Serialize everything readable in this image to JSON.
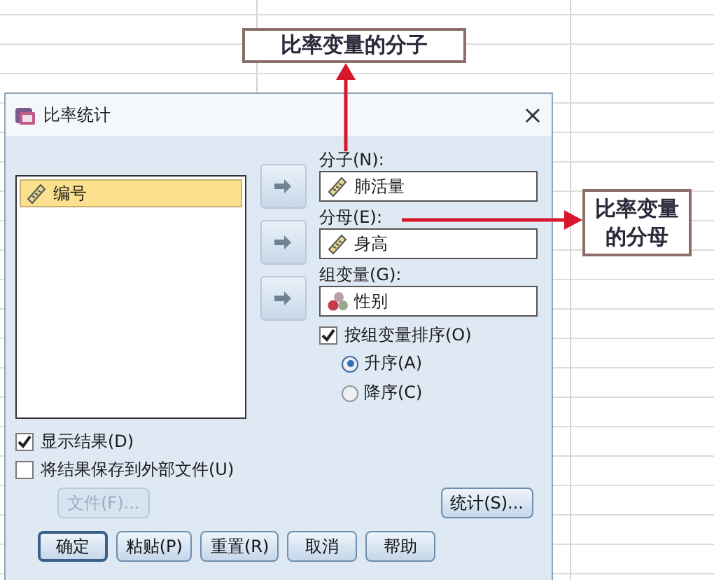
{
  "window": {
    "title": "比率统计"
  },
  "source_list": {
    "items": [
      {
        "label": "编号",
        "selected": true
      }
    ]
  },
  "targets": [
    {
      "label": "分子(N):",
      "value": "肺活量",
      "kind": "scale"
    },
    {
      "label": "分母(E):",
      "value": "身高",
      "kind": "scale"
    },
    {
      "label": "组变量(G):",
      "value": "性别",
      "kind": "nominal"
    }
  ],
  "sort_by_group": {
    "label": "按组变量排序(O)",
    "checked": true
  },
  "sort_order": [
    {
      "label": "升序(A)",
      "selected": true
    },
    {
      "label": "降序(C)",
      "selected": false
    }
  ],
  "options": [
    {
      "label": "显示结果(D)",
      "checked": true
    },
    {
      "label": "将结果保存到外部文件(U)",
      "checked": false
    }
  ],
  "file_button": {
    "label": "文件(F)...",
    "disabled": true
  },
  "statistics_button": {
    "label": "统计(S)..."
  },
  "buttons": [
    {
      "label": "确定",
      "default": true
    },
    {
      "label": "粘贴(P)",
      "default": false
    },
    {
      "label": "重置(R)",
      "default": false
    },
    {
      "label": "取消",
      "default": false
    },
    {
      "label": "帮助",
      "default": false
    }
  ],
  "annotations": [
    {
      "text": "比率变量的分子"
    },
    {
      "text": "比率变量的分母"
    }
  ]
}
